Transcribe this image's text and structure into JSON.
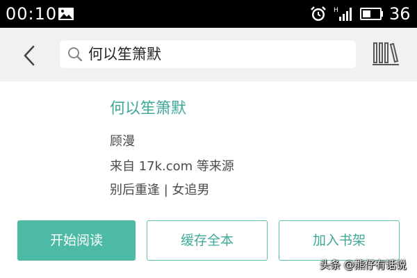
{
  "status_bar": {
    "time": "00:10",
    "battery_level": "36",
    "icons": [
      "image-icon",
      "alarm-icon",
      "signal-icon",
      "battery-icon"
    ]
  },
  "toolbar": {
    "back_icon": "chevron-left-icon",
    "search_icon": "search-icon",
    "search_query": "何以笙箫默",
    "bookshelf_icon": "bookshelf-icon"
  },
  "book": {
    "title": "何以笙箫默",
    "author": "顾漫",
    "source": "来自 17k.com 等来源",
    "tags": "别后重逢 | 女追男"
  },
  "actions": {
    "read_label": "开始阅读",
    "cache_label": "缓存全本",
    "shelf_label": "加入书架"
  },
  "watermark": "头条 @熊仔有话说",
  "colors": {
    "accent": "#4dbaa6",
    "title_text": "#3fa898",
    "status_bar_bg": "#000000",
    "toolbar_bg": "#f1f1f1"
  }
}
